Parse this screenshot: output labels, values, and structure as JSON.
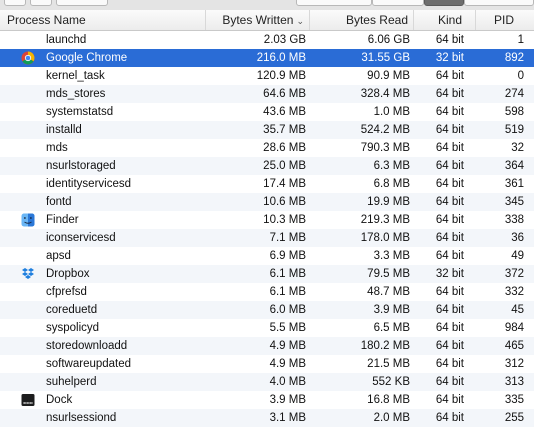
{
  "columns": {
    "process_name": "Process Name",
    "bytes_written": "Bytes Written",
    "bytes_read": "Bytes Read",
    "kind": "Kind",
    "pid": "PID",
    "sort_indicator": "⌄"
  },
  "colors": {
    "selection": "#2a6cd6",
    "alt_row": "#f3f6fa"
  },
  "rows": [
    {
      "name": "launchd",
      "bytes_written": "2.03 GB",
      "bytes_read": "6.06 GB",
      "kind": "64 bit",
      "pid": "1",
      "icon": ""
    },
    {
      "name": "Google Chrome",
      "bytes_written": "216.0 MB",
      "bytes_read": "31.55 GB",
      "kind": "32 bit",
      "pid": "892",
      "icon": "chrome-icon",
      "selected": true
    },
    {
      "name": "kernel_task",
      "bytes_written": "120.9 MB",
      "bytes_read": "90.9 MB",
      "kind": "64 bit",
      "pid": "0",
      "icon": ""
    },
    {
      "name": "mds_stores",
      "bytes_written": "64.6 MB",
      "bytes_read": "328.4 MB",
      "kind": "64 bit",
      "pid": "274",
      "icon": ""
    },
    {
      "name": "systemstatsd",
      "bytes_written": "43.6 MB",
      "bytes_read": "1.0 MB",
      "kind": "64 bit",
      "pid": "598",
      "icon": ""
    },
    {
      "name": "installd",
      "bytes_written": "35.7 MB",
      "bytes_read": "524.2 MB",
      "kind": "64 bit",
      "pid": "519",
      "icon": ""
    },
    {
      "name": "mds",
      "bytes_written": "28.6 MB",
      "bytes_read": "790.3 MB",
      "kind": "64 bit",
      "pid": "32",
      "icon": ""
    },
    {
      "name": "nsurlstoraged",
      "bytes_written": "25.0 MB",
      "bytes_read": "6.3 MB",
      "kind": "64 bit",
      "pid": "364",
      "icon": ""
    },
    {
      "name": "identityservicesd",
      "bytes_written": "17.4 MB",
      "bytes_read": "6.8 MB",
      "kind": "64 bit",
      "pid": "361",
      "icon": ""
    },
    {
      "name": "fontd",
      "bytes_written": "10.6 MB",
      "bytes_read": "19.9 MB",
      "kind": "64 bit",
      "pid": "345",
      "icon": ""
    },
    {
      "name": "Finder",
      "bytes_written": "10.3 MB",
      "bytes_read": "219.3 MB",
      "kind": "64 bit",
      "pid": "338",
      "icon": "finder-icon"
    },
    {
      "name": "iconservicesd",
      "bytes_written": "7.1 MB",
      "bytes_read": "178.0 MB",
      "kind": "64 bit",
      "pid": "36",
      "icon": ""
    },
    {
      "name": "apsd",
      "bytes_written": "6.9 MB",
      "bytes_read": "3.3 MB",
      "kind": "64 bit",
      "pid": "49",
      "icon": ""
    },
    {
      "name": "Dropbox",
      "bytes_written": "6.1 MB",
      "bytes_read": "79.5 MB",
      "kind": "32 bit",
      "pid": "372",
      "icon": "dropbox-icon"
    },
    {
      "name": "cfprefsd",
      "bytes_written": "6.1 MB",
      "bytes_read": "48.7 MB",
      "kind": "64 bit",
      "pid": "332",
      "icon": ""
    },
    {
      "name": "coreduetd",
      "bytes_written": "6.0 MB",
      "bytes_read": "3.9 MB",
      "kind": "64 bit",
      "pid": "45",
      "icon": ""
    },
    {
      "name": "syspolicyd",
      "bytes_written": "5.5 MB",
      "bytes_read": "6.5 MB",
      "kind": "64 bit",
      "pid": "984",
      "icon": ""
    },
    {
      "name": "storedownloadd",
      "bytes_written": "4.9 MB",
      "bytes_read": "180.2 MB",
      "kind": "64 bit",
      "pid": "465",
      "icon": ""
    },
    {
      "name": "softwareupdated",
      "bytes_written": "4.9 MB",
      "bytes_read": "21.5 MB",
      "kind": "64 bit",
      "pid": "312",
      "icon": ""
    },
    {
      "name": "suhelperd",
      "bytes_written": "4.0 MB",
      "bytes_read": "552 KB",
      "kind": "64 bit",
      "pid": "313",
      "icon": ""
    },
    {
      "name": "Dock",
      "bytes_written": "3.9 MB",
      "bytes_read": "16.8 MB",
      "kind": "64 bit",
      "pid": "335",
      "icon": "dock-icon"
    },
    {
      "name": "nsurlsessiond",
      "bytes_written": "3.1 MB",
      "bytes_read": "2.0 MB",
      "kind": "64 bit",
      "pid": "255",
      "icon": ""
    }
  ]
}
